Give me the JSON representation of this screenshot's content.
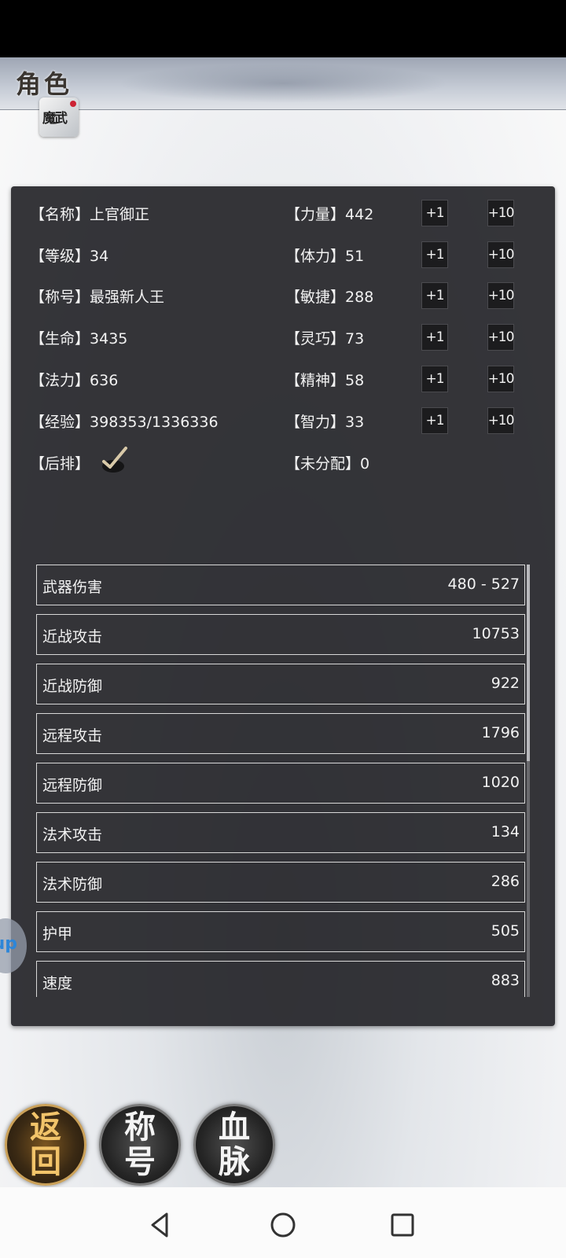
{
  "header": {
    "title": "角色",
    "logo_text": "魔武"
  },
  "character": {
    "left_attrs": [
      {
        "label": "【名称】",
        "value": "上官御正"
      },
      {
        "label": "【等级】",
        "value": "34"
      },
      {
        "label": "【称号】",
        "value": "最强新人王"
      },
      {
        "label": "【生命】",
        "value": "3435"
      },
      {
        "label": "【法力】",
        "value": "636"
      },
      {
        "label": "【经验】",
        "value": "398353/1336336"
      },
      {
        "label": "【后排】",
        "value": ""
      }
    ],
    "back_row_checked": true,
    "right_attrs": [
      {
        "label": "【力量】",
        "value": "442"
      },
      {
        "label": "【体力】",
        "value": "51"
      },
      {
        "label": "【敏捷】",
        "value": "288"
      },
      {
        "label": "【灵巧】",
        "value": "73"
      },
      {
        "label": "【精神】",
        "value": "58"
      },
      {
        "label": "【智力】",
        "value": "33"
      },
      {
        "label": "【未分配】",
        "value": "0"
      }
    ],
    "plus1_label": "+1",
    "plus10_label": "+10"
  },
  "stats": [
    {
      "label": "武器伤害",
      "value": "480 - 527"
    },
    {
      "label": "近战攻击",
      "value": "10753"
    },
    {
      "label": "近战防御",
      "value": "922"
    },
    {
      "label": "远程攻击",
      "value": "1796"
    },
    {
      "label": "远程防御",
      "value": "1020"
    },
    {
      "label": "法术攻击",
      "value": "134"
    },
    {
      "label": "法术防御",
      "value": "286"
    },
    {
      "label": "护甲",
      "value": "505"
    },
    {
      "label": "速度",
      "value": "883"
    }
  ],
  "floating_button": {
    "label": "up"
  },
  "bottom_buttons": {
    "back": "返回",
    "title": "称号",
    "bloodline": "血脉"
  },
  "icons": [
    "check-icon",
    "back-triangle-icon",
    "home-circle-icon",
    "recents-square-icon"
  ],
  "colors": {
    "panel": "#26262a",
    "text": "#f2f2f2",
    "gold": "#caa058"
  }
}
